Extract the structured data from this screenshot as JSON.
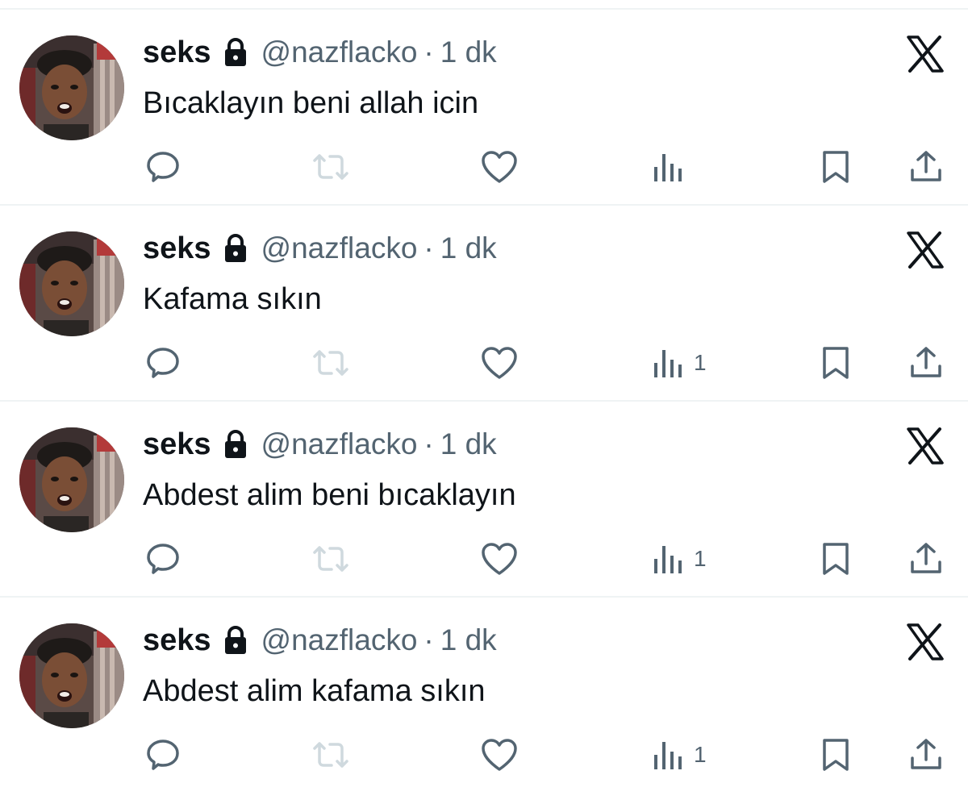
{
  "colors": {
    "text_primary": "#0f1419",
    "text_secondary": "#536471",
    "retweet_disabled": "#cfd9de",
    "divider": "#eff3f4"
  },
  "icons": {
    "lock": "lock-icon",
    "reply": "reply-icon",
    "retweet": "retweet-icon",
    "like": "heart-icon",
    "views": "bar-chart-icon",
    "bookmark": "bookmark-icon",
    "share": "share-icon",
    "platform": "x-logo-icon"
  },
  "tweets": [
    {
      "display_name": "seks",
      "handle": "@nazflacko",
      "separator": "·",
      "time": "1 dk",
      "text": "Bıcaklayın beni allah icin",
      "views": ""
    },
    {
      "display_name": "seks",
      "handle": "@nazflacko",
      "separator": "·",
      "time": "1 dk",
      "text": "Kafama sıkın",
      "views": "1"
    },
    {
      "display_name": "seks",
      "handle": "@nazflacko",
      "separator": "·",
      "time": "1 dk",
      "text": "Abdest alim beni bıcaklayın",
      "views": "1"
    },
    {
      "display_name": "seks",
      "handle": "@nazflacko",
      "separator": "·",
      "time": "1 dk",
      "text": "Abdest alim kafama sıkın",
      "views": "1"
    }
  ]
}
